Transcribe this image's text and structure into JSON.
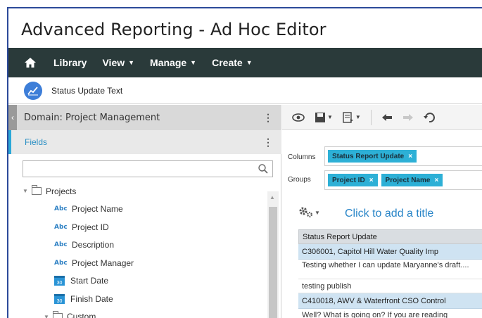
{
  "app": {
    "title": "Advanced Reporting - Ad Hoc Editor"
  },
  "nav": {
    "items": [
      "Library",
      "View",
      "Manage",
      "Create"
    ]
  },
  "report": {
    "name": "Status Update Text"
  },
  "left": {
    "domain_label": "Domain: Project Management",
    "fields_label": "Fields",
    "search": {
      "placeholder": ""
    },
    "tree": {
      "projects_label": "Projects",
      "fields": [
        {
          "type": "text",
          "label": "Project Name"
        },
        {
          "type": "text",
          "label": "Project ID"
        },
        {
          "type": "text",
          "label": "Description"
        },
        {
          "type": "text",
          "label": "Project Manager"
        },
        {
          "type": "date",
          "label": "Start Date"
        },
        {
          "type": "date",
          "label": "Finish Date"
        }
      ],
      "custom_label": "Custom",
      "text_icon_glyph": "Abc",
      "date_icon_glyph": "30"
    }
  },
  "right": {
    "columns_label": "Columns",
    "groups_label": "Groups",
    "columns": [
      "Status Report Update"
    ],
    "groups": [
      "Project ID",
      "Project Name"
    ],
    "add_title": "Click to add a title",
    "table": {
      "header": "Status Report Update",
      "group1": "C306001, Capitol Hill Water Quality Imp",
      "row1": "Testing whether I can update Maryanne's draft....",
      "row2": "testing publish",
      "group2": "C410018, AWV & Waterfront CSO Control",
      "row3": "Well? What is going on? If you are reading"
    }
  },
  "colors": {
    "nav_bg": "#2a3a3a",
    "chip": "#2db0d6",
    "accent": "#2a86c8"
  }
}
